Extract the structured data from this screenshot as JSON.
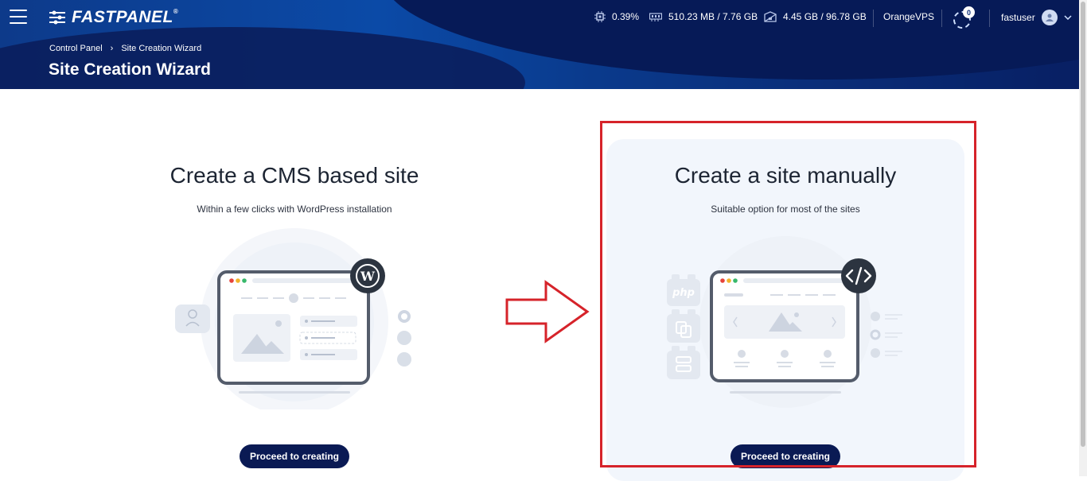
{
  "app": {
    "logo": "FASTPANEL",
    "logo_mark": "®"
  },
  "stats": {
    "cpu": "0.39%",
    "memory": "510.23 MB / 7.76 GB",
    "disk": "4.45 GB / 96.78 GB",
    "provider": "OrangeVPS",
    "tasks_count": "0"
  },
  "user": {
    "name": "fastuser"
  },
  "breadcrumb": {
    "root": "Control Panel",
    "separator": "›",
    "current": "Site Creation Wizard"
  },
  "page": {
    "title": "Site Creation Wizard"
  },
  "cards": [
    {
      "title": "Create a CMS based site",
      "subtitle": "Within a few clicks with WordPress installation",
      "button": "Proceed to creating",
      "badge_icon": "wordpress-icon"
    },
    {
      "title": "Create a site manually",
      "subtitle": "Suitable option for most of the sites",
      "button": "Proceed to creating",
      "badge_icon": "code-icon",
      "side_label": "php"
    }
  ],
  "colors": {
    "header": "#0b4aa7",
    "button": "#0a1a54",
    "highlight": "#d6232a",
    "arrow": "#d6232a"
  }
}
